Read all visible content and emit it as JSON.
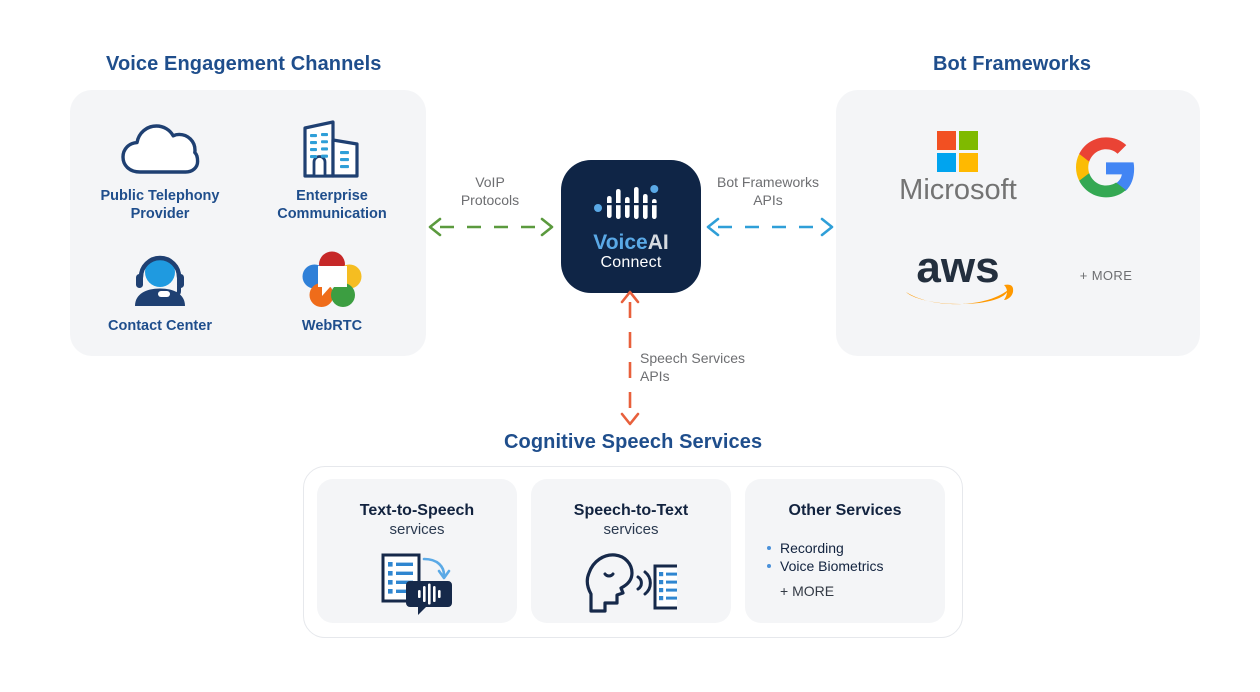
{
  "sections": {
    "voice_channels": {
      "title": "Voice Engagement Channels",
      "items": [
        {
          "label": "Public Telephony\nProvider",
          "icon": "cloud-icon"
        },
        {
          "label": "Enterprise\nCommunication",
          "icon": "office-building-icon"
        },
        {
          "label": "Contact Center",
          "icon": "headset-agent-icon"
        },
        {
          "label": "WebRTC",
          "icon": "webrtc-logo-icon"
        }
      ]
    },
    "bot_frameworks": {
      "title": "Bot Frameworks",
      "items": [
        {
          "label": "Microsoft",
          "icon": "microsoft-logo-icon"
        },
        {
          "label": "Google",
          "icon": "google-g-logo-icon"
        },
        {
          "label": "aws",
          "icon": "aws-logo-icon"
        },
        {
          "label": "+ MORE",
          "icon": "more-label"
        }
      ]
    },
    "cognitive_speech": {
      "title": "Cognitive Speech Services",
      "cards": [
        {
          "title": "Text-to-Speech",
          "subtitle": "services",
          "icon": "document-to-speech-bubble-icon"
        },
        {
          "title": "Speech-to-Text",
          "subtitle": "services",
          "icon": "speaking-head-to-document-icon"
        },
        {
          "title": "Other Services",
          "bullets": [
            "Recording",
            "Voice Biometrics"
          ],
          "more": "+ MORE"
        }
      ]
    }
  },
  "center_node": {
    "brand_part1": "Voice",
    "brand_part2": "AI",
    "brand_part3": "Connect",
    "icon": "voice-waveform-icon"
  },
  "connectors": [
    {
      "label": "VoIP\nProtocols",
      "direction": "bidirectional",
      "color": "#5b9a3e",
      "name": "voip-protocols"
    },
    {
      "label": "Bot Frameworks\nAPIs",
      "direction": "bidirectional",
      "color": "#2f9fd8",
      "name": "bot-frameworks-apis"
    },
    {
      "label": "Speech Services\nAPIs",
      "direction": "bidirectional",
      "color": "#e8603c",
      "name": "speech-services-apis"
    }
  ],
  "colors": {
    "heading": "#1f4e8c",
    "panel_bg": "#f4f5f7",
    "center_bg": "#0f2546",
    "brand_blue": "#5aa9e6",
    "green_arrow": "#5b9a3e",
    "blue_arrow": "#2f9fd8",
    "orange_arrow": "#e8603c",
    "label_grey": "#6d6e71"
  }
}
